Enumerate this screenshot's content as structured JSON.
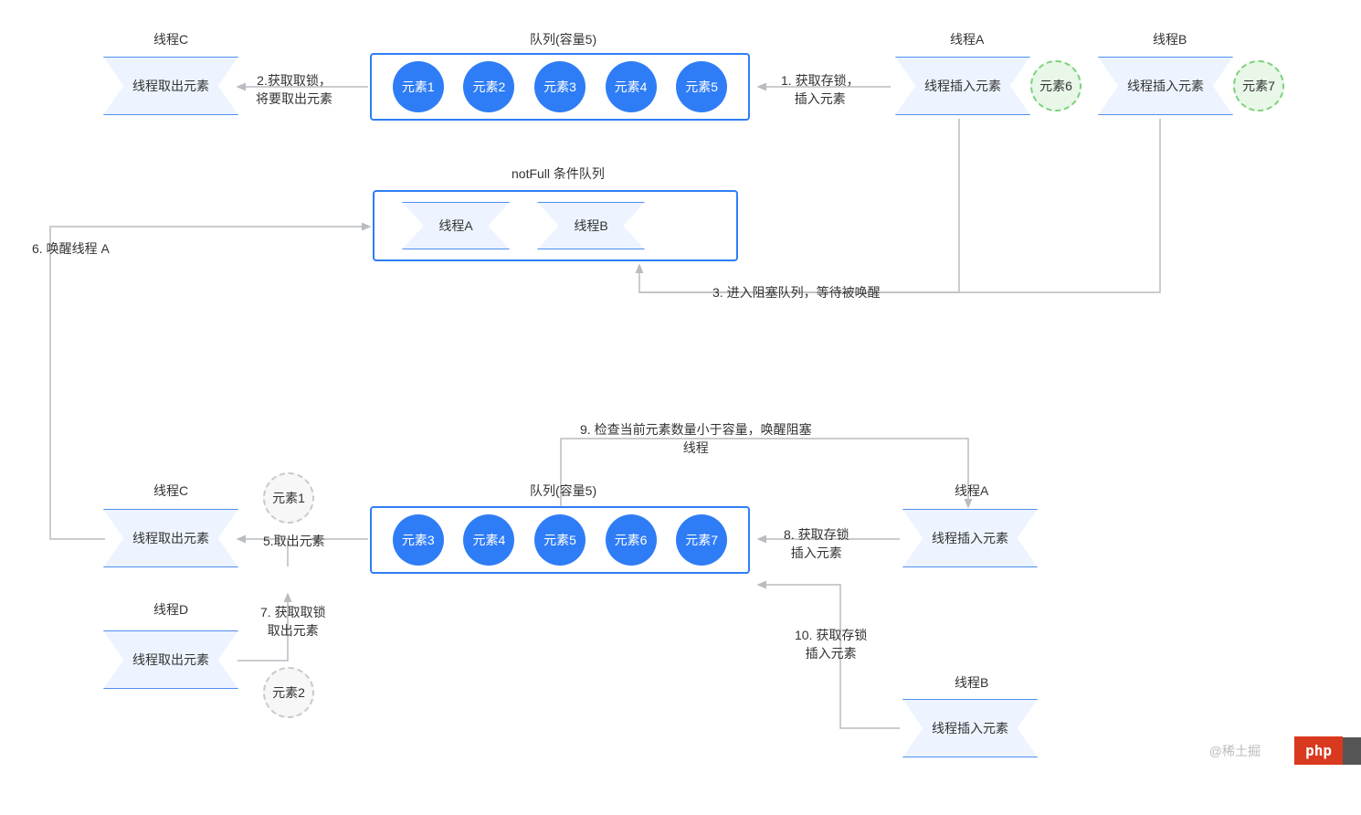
{
  "top": {
    "threadC": {
      "title": "线程C",
      "box": "线程取出元素"
    },
    "queue": {
      "title": "队列(容量5)",
      "items": [
        "元素1",
        "元素2",
        "元素3",
        "元素4",
        "元素5"
      ]
    },
    "threadA": {
      "title": "线程A",
      "box": "线程插入元素",
      "elem": "元素6"
    },
    "threadB": {
      "title": "线程B",
      "box": "线程插入元素",
      "elem": "元素7"
    }
  },
  "edges": {
    "e1": "1. 获取存锁，\n插入元素",
    "e2": "2.获取取锁，\n将要取出元素",
    "e3": "3. 进入阻塞队列，等待被唤醒",
    "e5": "5.取出元素",
    "e6": "6. 唤醒线程 A",
    "e7": "7. 获取取锁\n取出元素",
    "e8": "8. 获取存锁\n插入元素",
    "e9": "9. 检查当前元素数量小于容量，唤醒阻塞\n线程",
    "e10": "10. 获取存锁\n插入元素"
  },
  "cond": {
    "title": "notFull 条件队列",
    "threads": [
      "线程A",
      "线程B"
    ]
  },
  "bottom": {
    "threadC": {
      "title": "线程C",
      "box": "线程取出元素"
    },
    "threadD": {
      "title": "线程D",
      "box": "线程取出元素"
    },
    "popped": [
      "元素1",
      "元素2"
    ],
    "queue": {
      "title": "队列(容量5)",
      "items": [
        "元素3",
        "元素4",
        "元素5",
        "元素6",
        "元素7"
      ]
    },
    "threadA": {
      "title": "线程A",
      "box": "线程插入元素"
    },
    "threadB": {
      "title": "线程B",
      "box": "线程插入元素"
    }
  },
  "watermark": "@稀土掘"
}
